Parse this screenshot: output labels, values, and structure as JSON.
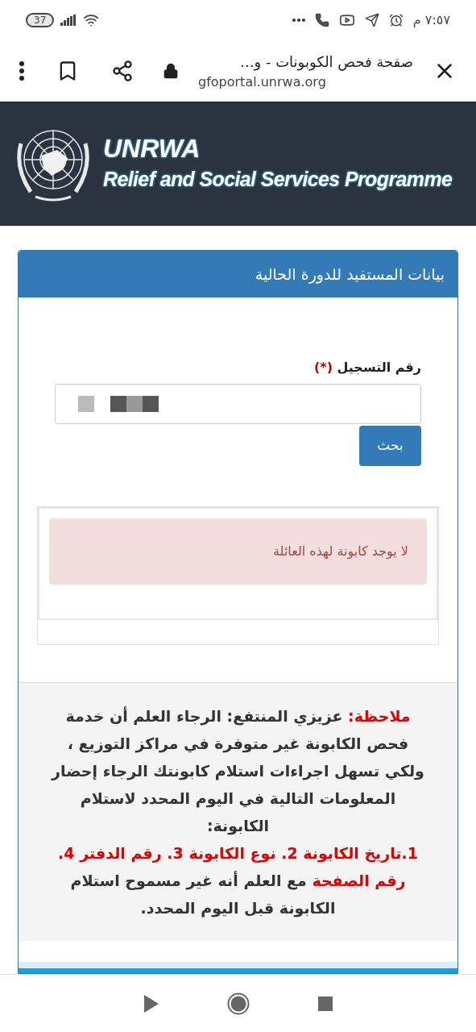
{
  "status_bar": {
    "time": "٧:٥٧ م",
    "battery": "37"
  },
  "browser": {
    "title": "صفحة فحص الكوبونات - و...",
    "url": "gfoportal.unrwa.org"
  },
  "banner": {
    "title": "UNRWA",
    "subtitle": "Relief and Social Services Programme"
  },
  "panel": {
    "title": "بيانات المستفيد للدورة الحالية",
    "field": {
      "label": "رقم التسجيل",
      "required_mark": "(*)"
    },
    "button": "بحث",
    "alert": "لا يوجد كابونة لهذه العائلة",
    "note": [
      {
        "text": "ملاحظة:",
        "highlight": true,
        "new_line": false
      },
      {
        "text": " عزيزي المنتفع: الرجاء العلم أن خدمة فحص الكابونة غير متوفرة في مراكز التوزيع ، ولكي تسهل اجراءات استلام كابونتك الرجاء إحضار المعلومات التالية في اليوم المحدد لاستلام الكابونة:",
        "highlight": false,
        "new_line": false
      },
      {
        "text": "1.تاريخ الكابونة 2. نوع الكابونة 3. رقم الدفتر 4. رقم الصفحة",
        "highlight": true,
        "new_line": true
      },
      {
        "text": " مع العلم أنه غير مسموح استلام الكابونة قبل اليوم المحدد.",
        "highlight": false,
        "new_line": false
      }
    ]
  }
}
